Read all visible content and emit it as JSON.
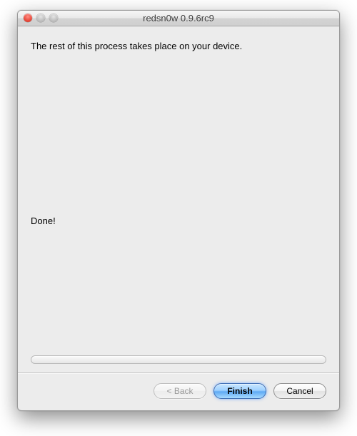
{
  "window": {
    "title": "redsn0w 0.9.6rc9"
  },
  "content": {
    "message_primary": "The rest of this process takes place on your device.",
    "status_text": "Done!"
  },
  "buttons": {
    "back_label": "< Back",
    "finish_label": "Finish",
    "cancel_label": "Cancel"
  }
}
